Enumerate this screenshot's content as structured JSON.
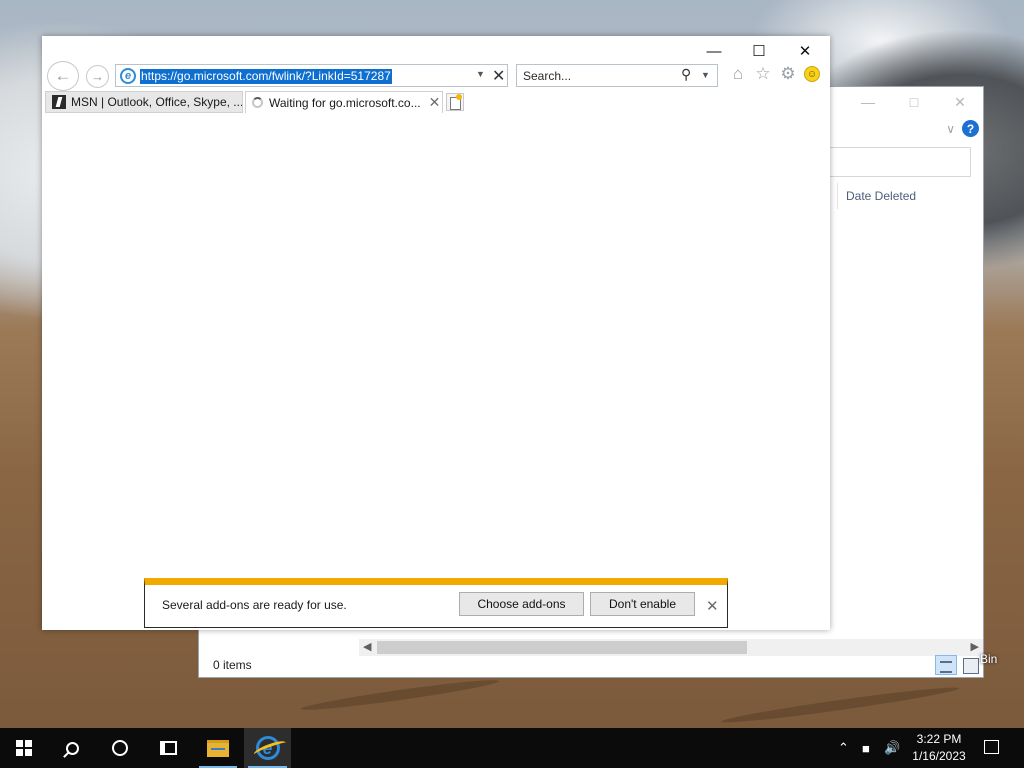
{
  "recycle_bin": {
    "column_header": "Date Deleted",
    "status": "0 items",
    "desktop_label": "Bin"
  },
  "browser": {
    "address_url": "https://go.microsoft.com/fwlink/?LinkId=517287",
    "search_placeholder": "Search...",
    "tabs": [
      {
        "label": "MSN | Outlook, Office, Skype, ..."
      },
      {
        "label": "Waiting for go.microsoft.co..."
      }
    ],
    "notification": {
      "message": "Several add-ons are ready for use.",
      "choose_label": "Choose add-ons",
      "dont_enable_label": "Don't enable"
    }
  },
  "taskbar": {
    "time": "3:22 PM",
    "date": "1/16/2023"
  },
  "colors": {
    "ie_accent": "#2e8bd9",
    "notification_bar": "#f2a900",
    "url_selection": "#0e6fd0",
    "taskbar": "#0b0b0b"
  }
}
